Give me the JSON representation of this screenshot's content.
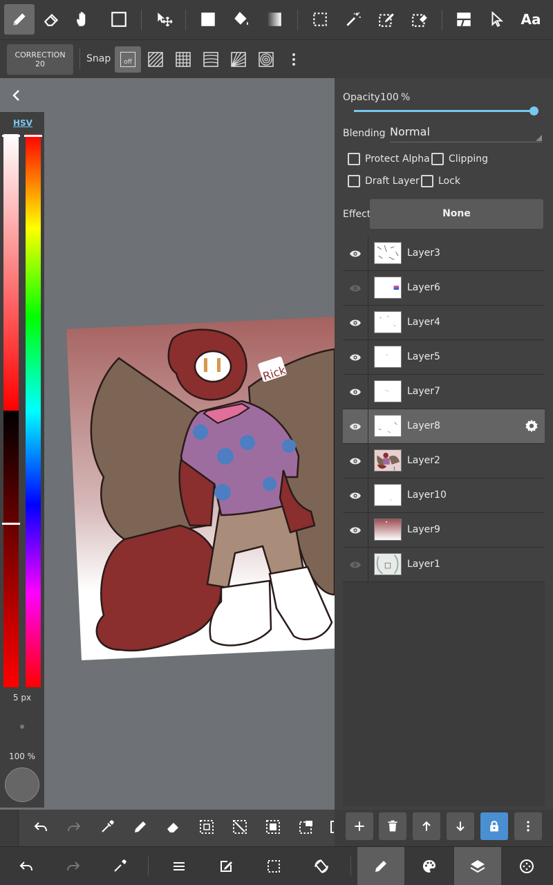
{
  "top_toolbar": {
    "tools": [
      "pen-icon",
      "eraser-icon",
      "hand-icon",
      "rectangle-icon",
      "move-icon",
      "fill-rect-icon",
      "bucket-icon",
      "gradient-icon",
      "select-rect-icon",
      "magic-wand-icon",
      "select-pen-icon",
      "select-eraser-icon",
      "layer-shape-icon",
      "pointer-icon",
      "text-icon"
    ],
    "text_tool_label": "Aa"
  },
  "sub_toolbar": {
    "correction_label": "CORRECTION",
    "correction_value": "20",
    "snap_label": "Snap",
    "snap_off_label": "off"
  },
  "color_panel": {
    "mode_label": "HSV",
    "brush_size": "5 px",
    "brush_opacity": "100 %",
    "colors": {
      "saturation_top": "#ffffff",
      "hue": "#ff0000",
      "current": "#666666"
    }
  },
  "layer_panel": {
    "opacity_label": "Opacity",
    "opacity_value": "100",
    "opacity_unit": "%",
    "opacity_fraction": 1.0,
    "blending_label": "Blending",
    "blending_value": "Normal",
    "protect_alpha_label": "Protect Alpha",
    "clipping_label": "Clipping",
    "draft_layer_label": "Draft Layer",
    "lock_label": "Lock",
    "effect_label": "Effect",
    "effect_value": "None",
    "layers": [
      {
        "name": "Layer3",
        "visible": true,
        "selected": false
      },
      {
        "name": "Layer6",
        "visible": false,
        "selected": false
      },
      {
        "name": "Layer4",
        "visible": true,
        "selected": false
      },
      {
        "name": "Layer5",
        "visible": true,
        "selected": false
      },
      {
        "name": "Layer7",
        "visible": true,
        "selected": false
      },
      {
        "name": "Layer8",
        "visible": true,
        "selected": true
      },
      {
        "name": "Layer2",
        "visible": true,
        "selected": false
      },
      {
        "name": "Layer10",
        "visible": true,
        "selected": false
      },
      {
        "name": "Layer9",
        "visible": true,
        "selected": false
      },
      {
        "name": "Layer1",
        "visible": false,
        "selected": false
      }
    ]
  },
  "canvas": {
    "artwork_text": "Rick",
    "accent": "#79c8f0"
  }
}
